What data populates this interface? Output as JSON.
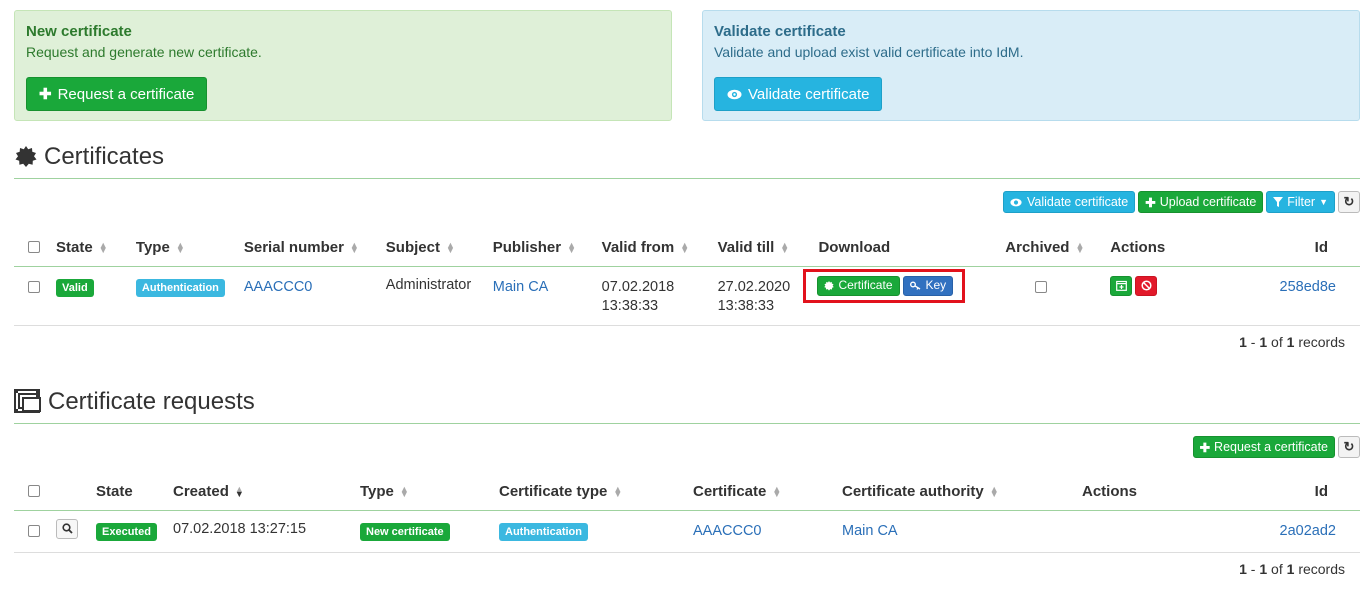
{
  "new_panel": {
    "title": "New certificate",
    "description": "Request and generate new certificate.",
    "button": "Request a certificate"
  },
  "validate_panel": {
    "title": "Validate certificate",
    "description": "Validate and upload exist valid certificate into IdM.",
    "button": "Validate certificate"
  },
  "certificates": {
    "title": "Certificates",
    "toolbar": {
      "validate": "Validate certificate",
      "upload": "Upload certificate",
      "filter": "Filter"
    },
    "columns": [
      "State",
      "Type",
      "Serial number",
      "Subject",
      "Publisher",
      "Valid from",
      "Valid till",
      "Download",
      "Archived",
      "Actions",
      "Id"
    ],
    "rows": [
      {
        "state": "Valid",
        "type": "Authentication",
        "serial": "AAACCC0",
        "subject": "Administrator",
        "publisher": "Main CA",
        "valid_from_date": "07.02.2018",
        "valid_from_time": "13:38:33",
        "valid_till_date": "27.02.2020",
        "valid_till_time": "13:38:33",
        "download_certificate": "Certificate",
        "download_key": "Key",
        "archived": false,
        "id": "258ed8e"
      }
    ],
    "records": {
      "from": "1",
      "to": "1",
      "of_label": "of",
      "total": "1",
      "suffix": "records"
    }
  },
  "requests": {
    "title": "Certificate requests",
    "toolbar": {
      "request": "Request a certificate"
    },
    "columns": [
      "State",
      "Created",
      "Type",
      "Certificate type",
      "Certificate",
      "Certificate authority",
      "Actions",
      "Id"
    ],
    "rows": [
      {
        "state": "Executed",
        "created": "07.02.2018 13:27:15",
        "type": "New certificate",
        "certificate_type": "Authentication",
        "certificate": "AAACCC0",
        "authority": "Main CA",
        "id": "2a02ad2"
      }
    ],
    "records": {
      "from": "1",
      "to": "1",
      "of_label": "of",
      "total": "1",
      "suffix": "records"
    }
  },
  "colors": {
    "success": "#1aa83a",
    "info": "#26b4e0",
    "primary": "#3171c0",
    "danger": "#e2192a",
    "link": "#2a6fb8",
    "highlight": "#e2121c"
  }
}
